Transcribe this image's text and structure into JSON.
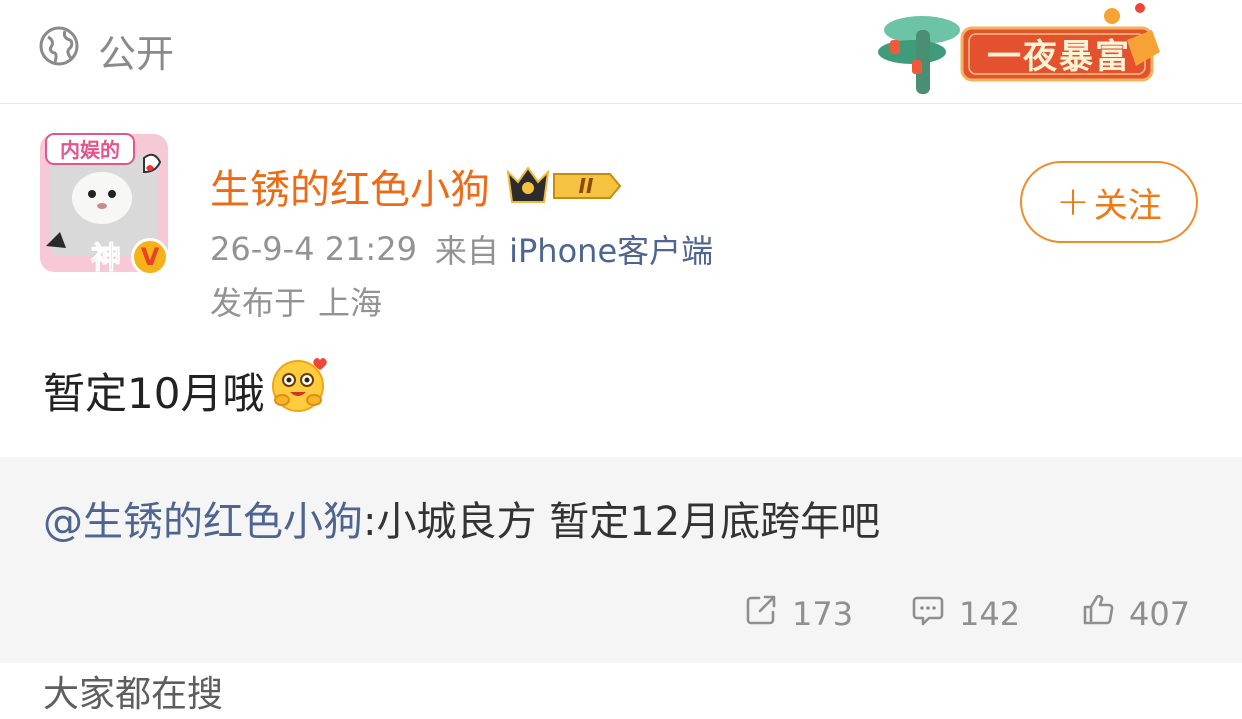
{
  "header": {
    "visibility_icon": "globe-icon",
    "visibility_label": "公开",
    "banner_label": "一夜暴富"
  },
  "author": {
    "avatar_caption": "内娱的",
    "avatar_caption_2": "神",
    "verified_badge": "V",
    "name": "生锈的红色小狗",
    "member_level": "II",
    "time": "26-9-4 21:29",
    "source_prefix": "来自",
    "source": "iPhone客户端",
    "location_prefix": "发布于",
    "location": "上海",
    "follow_symbol": "+",
    "follow_label": "关注"
  },
  "post": {
    "text": "暂定10月哦",
    "emoji": "hug-emoji"
  },
  "repost": {
    "mention": "@生锈的红色小狗",
    "text": ":小城良方 暂定12月底跨年吧"
  },
  "stats": {
    "reposts": "173",
    "comments": "142",
    "likes": "407"
  },
  "section": {
    "title": "大家都在搜"
  },
  "colors": {
    "accent": "#ee6a15",
    "link": "#4d6590",
    "muted": "#939393",
    "repost_bg": "#f5f5f5"
  }
}
